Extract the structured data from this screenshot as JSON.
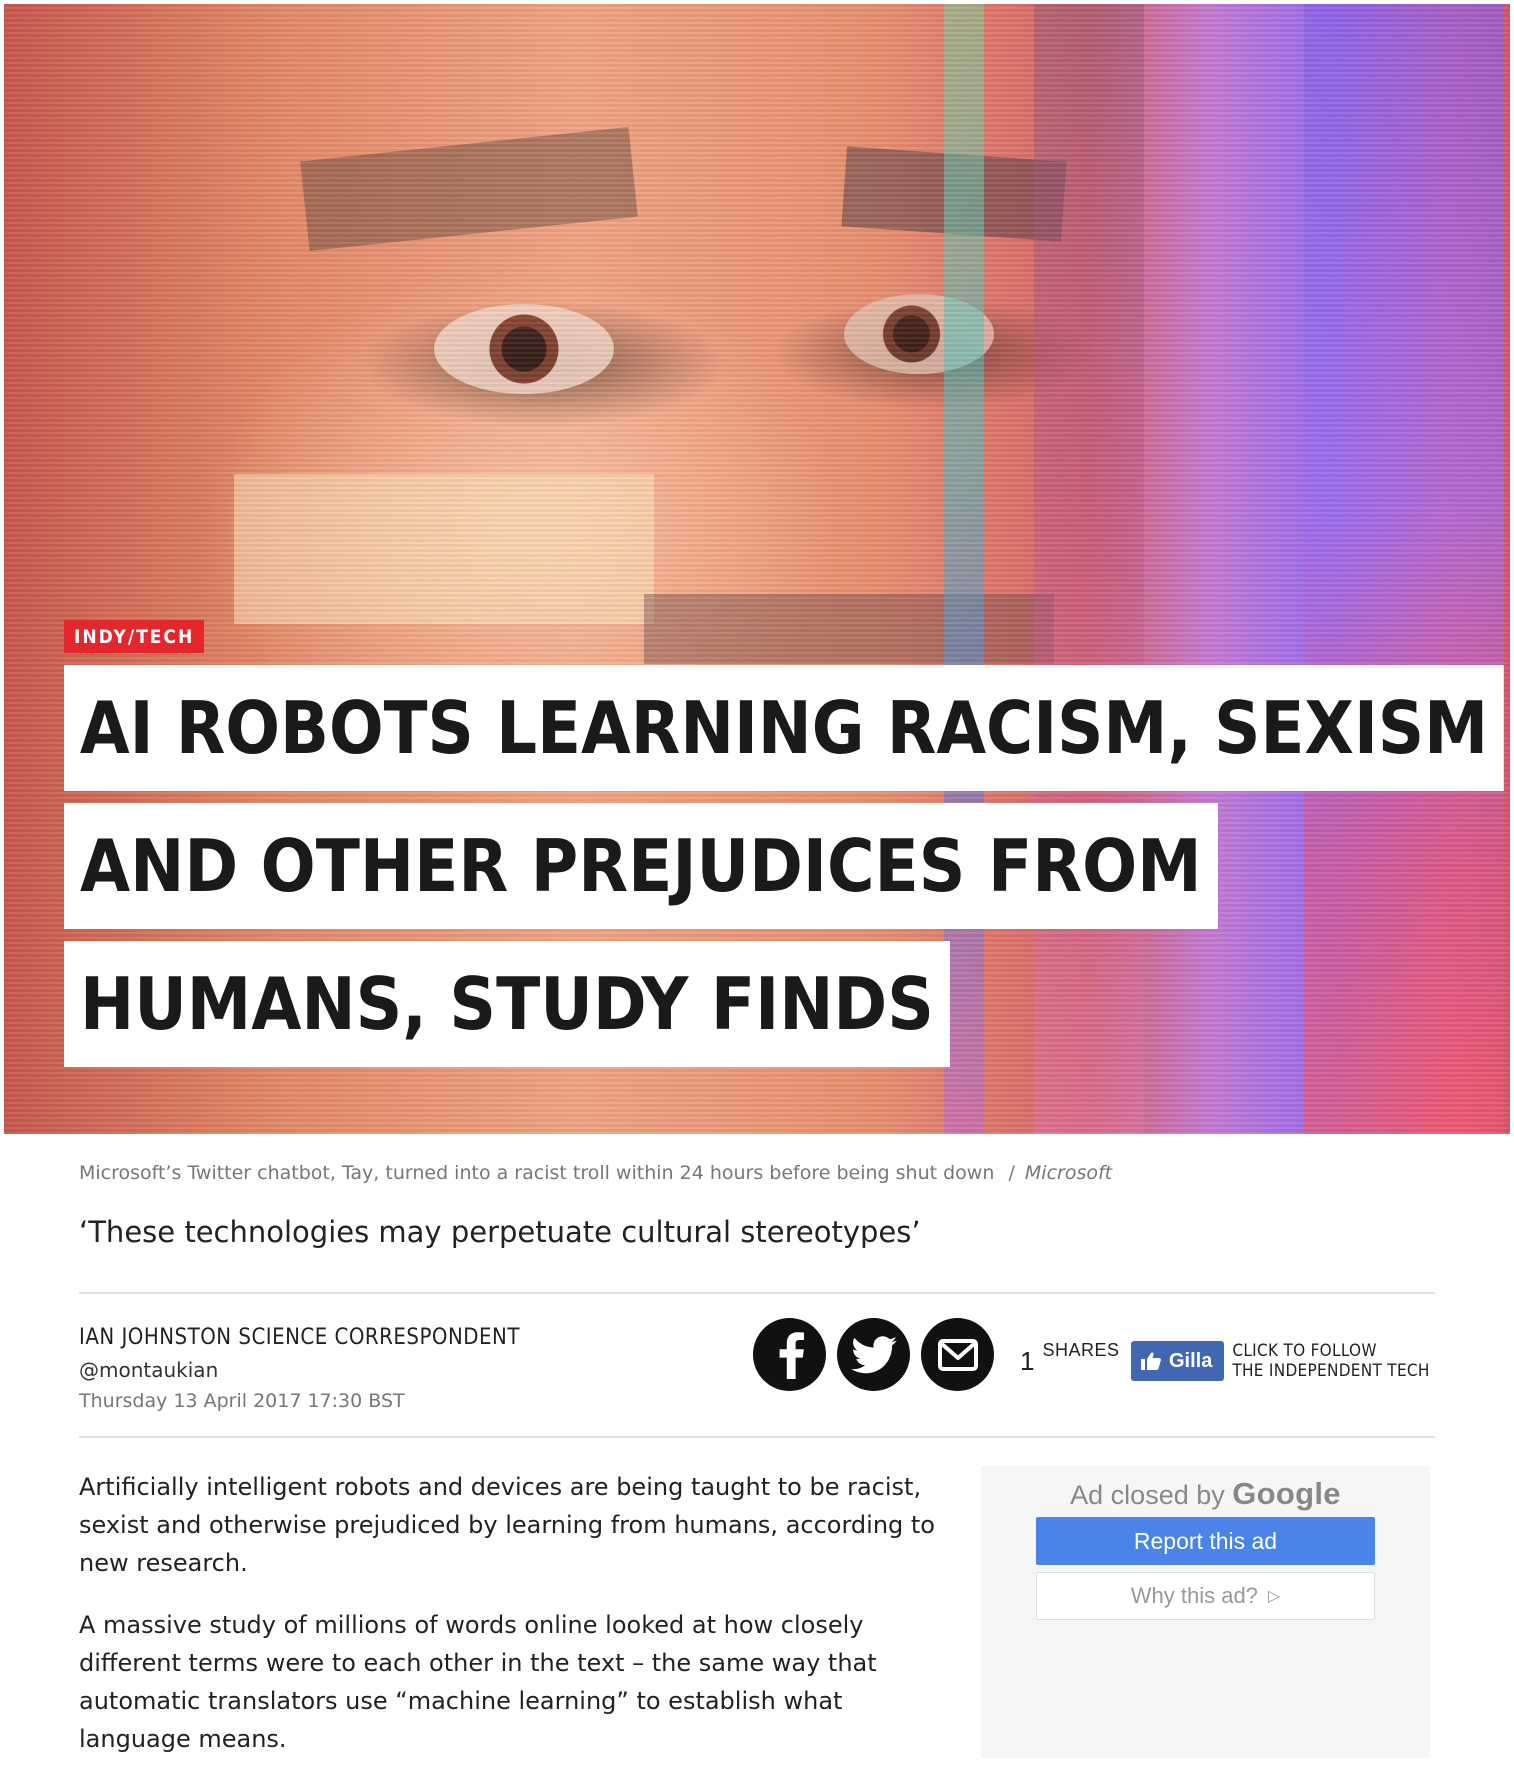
{
  "hero": {
    "section_tag": "INDY/TECH",
    "headline_lines": [
      "AI ROBOTS LEARNING RACISM, SEXISM",
      "AND OTHER PREJUDICES FROM",
      "HUMANS, STUDY FINDS"
    ]
  },
  "caption": {
    "text": "Microsoft’s Twitter chatbot, Tay, turned into a racist troll within 24 hours before being shut down",
    "separator": "/",
    "credit": "Microsoft"
  },
  "standfirst": "‘These technologies may perpetuate cultural stereotypes’",
  "byline": {
    "author": "IAN JOHNSTON SCIENCE CORRESPONDENT",
    "handle": "@montaukian",
    "date": "Thursday 13 April 2017 17:30 BST"
  },
  "share": {
    "icons": [
      "facebook-icon",
      "twitter-icon",
      "email-icon"
    ],
    "count": "1",
    "count_label": "SHARES"
  },
  "follow": {
    "button_label": "Gilla",
    "text_line1": "CLICK TO FOLLOW",
    "text_line2": "THE INDEPENDENT TECH",
    "color": "#4267b2"
  },
  "body": {
    "paragraphs": [
      "Artificially intelligent robots and devices are being taught to be racist, sexist and otherwise prejudiced by learning from humans, according to new research.",
      "A massive study of millions of words online looked at how closely different terms were to each other in the text – the same way that automatic translators use “machine learning” to establish what language means."
    ]
  },
  "ad": {
    "closed_prefix": "Ad closed by",
    "closed_brand": "Google",
    "report_label": "Report this ad",
    "why_label": "Why this ad?",
    "report_color": "#4a84e9"
  },
  "colors": {
    "tag_red": "#e4262d",
    "text": "#222222",
    "muted": "#777777"
  }
}
